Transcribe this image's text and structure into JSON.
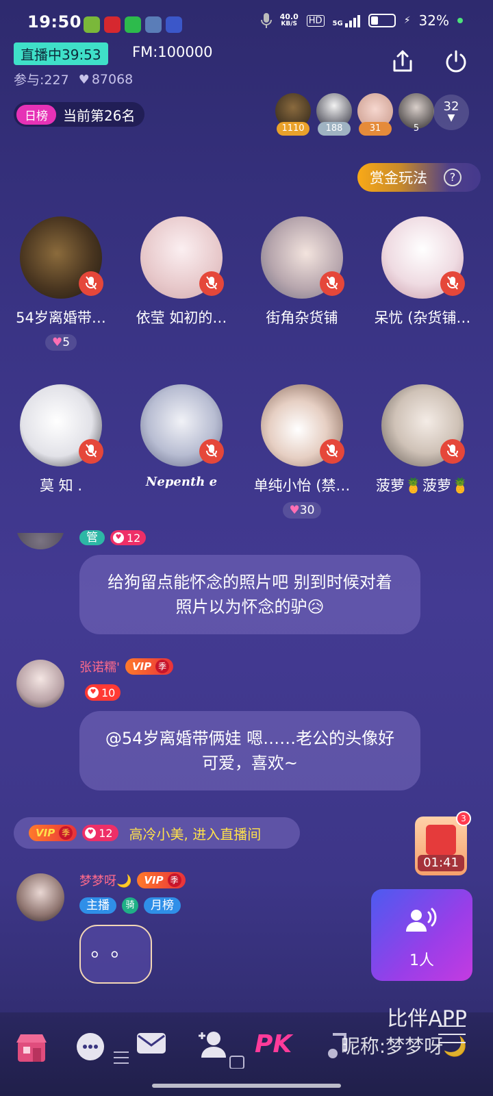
{
  "status_bar": {
    "time": "19:50",
    "net_speed": "40.0",
    "net_unit": "KB/S",
    "signal": "5G",
    "battery": "32%"
  },
  "header": {
    "live_label": "直播中39:53",
    "fm": "FM:100000",
    "participants": "参与:227",
    "hearts": "87068",
    "rank_tag": "日榜",
    "rank_text": "当前第26名",
    "fans": [
      {
        "value": "1110",
        "color": "#e9a12a"
      },
      {
        "value": "188",
        "color": "#9fb3c2"
      },
      {
        "value": "31",
        "color": "#e58b3a"
      },
      {
        "value": "5",
        "color": "transparent"
      }
    ],
    "more_count": "32",
    "bounty_label": "赏金玩法"
  },
  "seats": [
    {
      "name": "54岁离婚带…",
      "likes": "5",
      "bg": "#3b3024"
    },
    {
      "name": "依莹 如初的…",
      "likes": "",
      "bg": "#f3e2e6"
    },
    {
      "name": "街角杂货铺",
      "likes": "",
      "bg": "#e8dfe0"
    },
    {
      "name": "呆忧 (杂货铺…",
      "likes": "",
      "bg": "#f5eef2"
    },
    {
      "name": "莫 知 .",
      "likes": "",
      "bg": "#e9e9ee"
    },
    {
      "name": "Nepenth e",
      "likes": "",
      "bg": "#dcdfe9"
    },
    {
      "name": "单纯小怡 (禁…",
      "likes": "30",
      "bg": "#e7d9d0"
    },
    {
      "name": "菠萝🍍菠萝🍍",
      "likes": "",
      "bg": "#e8e4e0"
    }
  ],
  "chat": {
    "msg1_tag": "管",
    "msg1_level": "12",
    "msg1_text": "给狗留点能怀念的照片吧 别到时候对着照片以为怀念的驴😥",
    "msg2_user": "张诺糯'",
    "msg2_vip": "VIP",
    "msg2_season": "季",
    "msg2_level": "10",
    "msg2_text": "@54岁离婚带俩娃 嗯……老公的头像好可爱，喜欢~",
    "enter_vip": "VIP",
    "enter_season": "季",
    "enter_level": "12",
    "enter_text": "高冷小美, 进入直播间",
    "msg3_user": "梦梦呀🌙",
    "msg3_vip": "VIP",
    "msg3_season": "季",
    "msg3_tag_host": "主播",
    "msg3_tag_ride": "骑",
    "msg3_tag_month": "月榜",
    "msg3_text": "。。"
  },
  "red_packet": {
    "timer": "01:41",
    "badge": "3"
  },
  "mic_queue": {
    "count": "1人"
  },
  "bottom": {
    "pk": "PK",
    "watermark_app": "比伴APP",
    "watermark_nick": "昵称:梦梦呀🌙"
  }
}
